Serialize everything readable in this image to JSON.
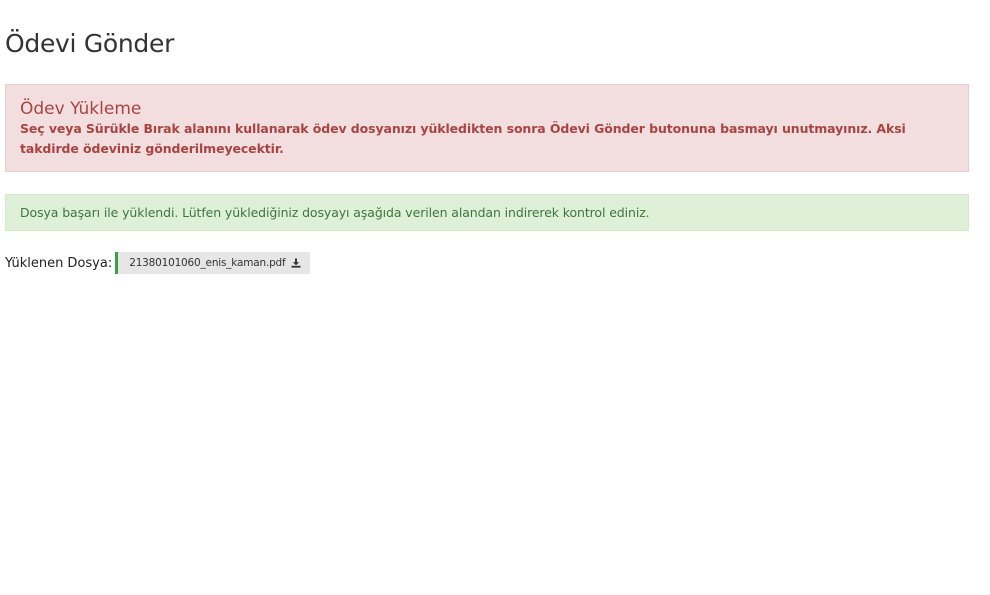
{
  "page": {
    "title": "Ödevi Gönder"
  },
  "upload_alert": {
    "title": "Ödev Yükleme",
    "message": "Seç veya Sürükle Bırak alanını kullanarak ödev dosyanızı yükledikten sonra Ödevi Gönder butonuna basmayı unutmayınız. Aksi takdirde ödeviniz gönderilmeyecektir."
  },
  "success_alert": {
    "message": "Dosya başarı ile yüklendi. Lütfen yüklediğiniz dosyayı aşağıda verilen alandan indirerek kontrol ediniz."
  },
  "uploaded_file": {
    "label": "Yüklenen Dosya:",
    "file_name": "21380101060_enis_kaman.pdf",
    "icon": "download-icon"
  },
  "colors": {
    "danger_bg": "#f2dede",
    "danger_text": "#a94442",
    "success_bg": "#dff0d8",
    "success_text": "#3c763d",
    "file_accent": "#3aa04a"
  }
}
